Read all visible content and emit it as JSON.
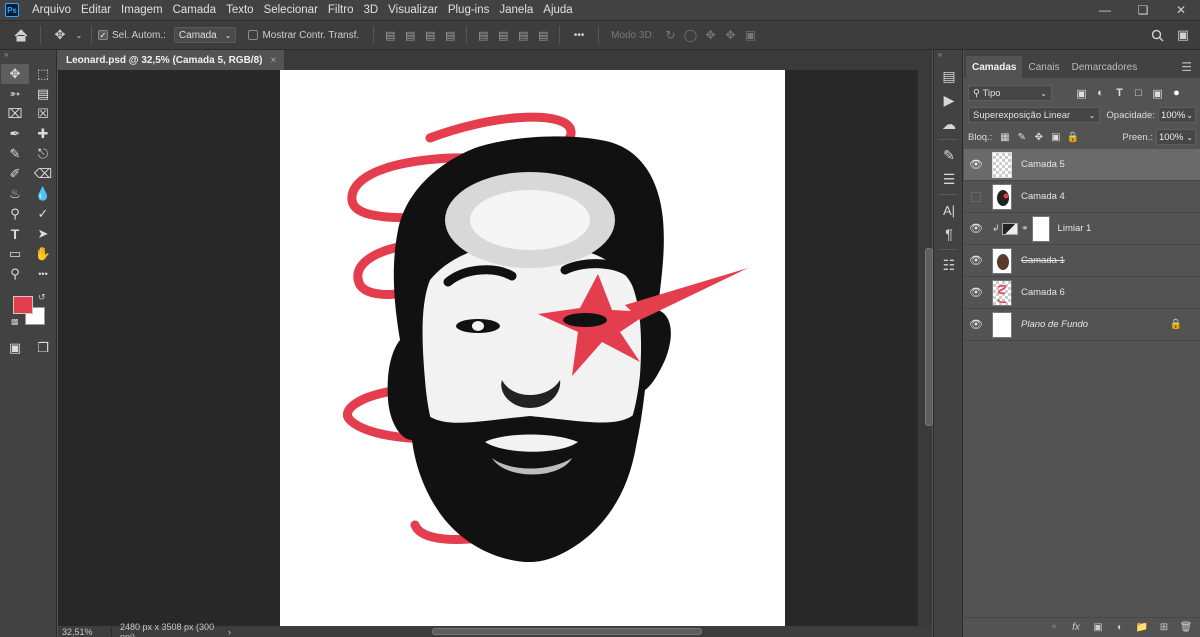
{
  "menubar": {
    "logo": "Ps",
    "items": [
      "Arquivo",
      "Editar",
      "Imagem",
      "Camada",
      "Texto",
      "Selecionar",
      "Filtro",
      "3D",
      "Visualizar",
      "Plug-ins",
      "Janela",
      "Ajuda"
    ],
    "window_controls": [
      "minimize-icon",
      "restore-icon",
      "close-icon"
    ]
  },
  "options": {
    "auto_select_label": "Sel. Autom.:",
    "auto_select_checked": true,
    "target_select": "Camada",
    "show_transform_label": "Mostrar Contr. Transf.",
    "show_transform_checked": false,
    "more": "•••",
    "mode3d_label": "Modo 3D:"
  },
  "document": {
    "tab_title": "Leonard.psd @ 32,5% (Camada 5, RGB/8)",
    "close_glyph": "×",
    "zoom": "32,51%",
    "size_info": "2480 px x 3508 px (300 ppi)",
    "status_arrow": "›"
  },
  "colors": {
    "foreground": "#e43d4e",
    "background": "#ffffff",
    "accent_red": "#e43d4e",
    "selected_layer": "#6a6a6a"
  },
  "panel": {
    "tabs": [
      "Camadas",
      "Canais",
      "Demarcadores"
    ],
    "filter_kind": "Tipo",
    "blend_mode": "Superexposição Linear",
    "opacity_label": "Opacidade:",
    "opacity_value": "100%",
    "lock_label": "Bloq.:",
    "fill_label": "Preen.:",
    "fill_value": "100%"
  },
  "layers": [
    {
      "name": "Camada 5",
      "visible": true,
      "selected": true
    },
    {
      "name": "Camada 4",
      "visible": false,
      "selected": false
    },
    {
      "name": "Limiar 1",
      "visible": true,
      "selected": false
    },
    {
      "name": "Camada 1",
      "visible": true,
      "selected": false
    },
    {
      "name": "Camada 6",
      "visible": true,
      "selected": false
    },
    {
      "name": "Plano de Fundo",
      "visible": true,
      "selected": false
    }
  ]
}
